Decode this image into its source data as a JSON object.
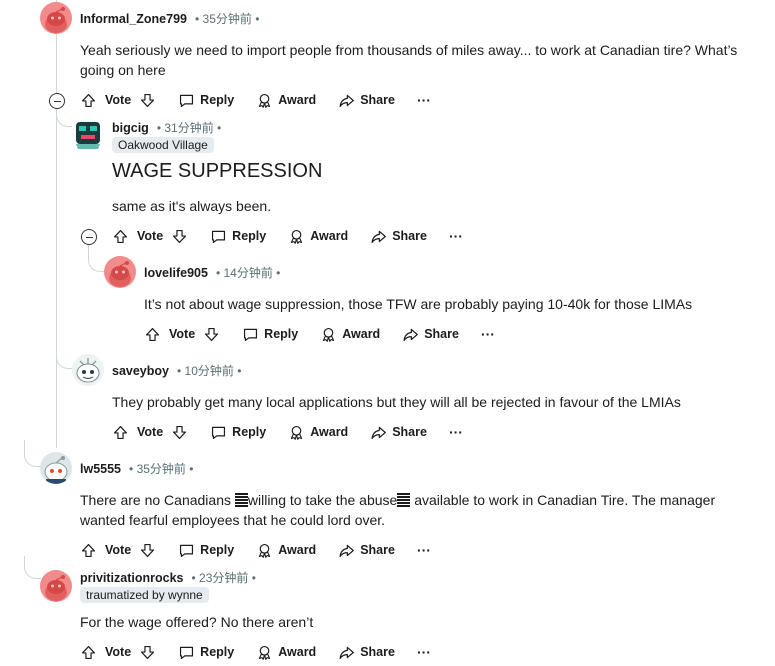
{
  "actions": {
    "vote": "Vote",
    "reply": "Reply",
    "award": "Award",
    "share": "Share",
    "more": "···"
  },
  "colors": {
    "text": "#1c1c1c",
    "meta": "#576f76",
    "flair_bg": "#e5ebee",
    "thread_line": "#d0d7da",
    "avatar_pink": "#f28b8b"
  },
  "comments": [
    {
      "user": "Informal_Zone799",
      "time": "35分钟前",
      "body": "Yeah seriously we need to import people from thousands of miles away... to work at Canadian tire? What’s going on here",
      "avatar": "snoo-pink"
    },
    {
      "user": "bigcig",
      "time": "31分钟前",
      "flair": "Oakwood Village",
      "title": "WAGE SUPPRESSION",
      "body": "same as it's always been.",
      "avatar": "snoo-robot"
    },
    {
      "user": "lovelife905",
      "time": "14分钟前",
      "body": "It’s not about wage suppression, those TFW are probably paying 10-40k for those LIMAs",
      "avatar": "snoo-pink"
    },
    {
      "user": "saveyboy",
      "time": "10分钟前",
      "body": "They probably get many local applications but they will all be rejected in favour of the LMIAs",
      "avatar": "snoo-gray"
    },
    {
      "user": "lw5555",
      "time": "35分钟前",
      "body_parts": [
        "There are no Canadians ",
        "willing to take the abuse",
        " available to work in Canadian Tire. The manager wanted fearful employees that he could lord over."
      ],
      "avatar": "snoo-white"
    },
    {
      "user": "privitizationrocks",
      "time": "23分钟前",
      "flair": "traumatized by wynne",
      "body": "For the wage offered? No there aren’t",
      "avatar": "snoo-pink"
    }
  ]
}
